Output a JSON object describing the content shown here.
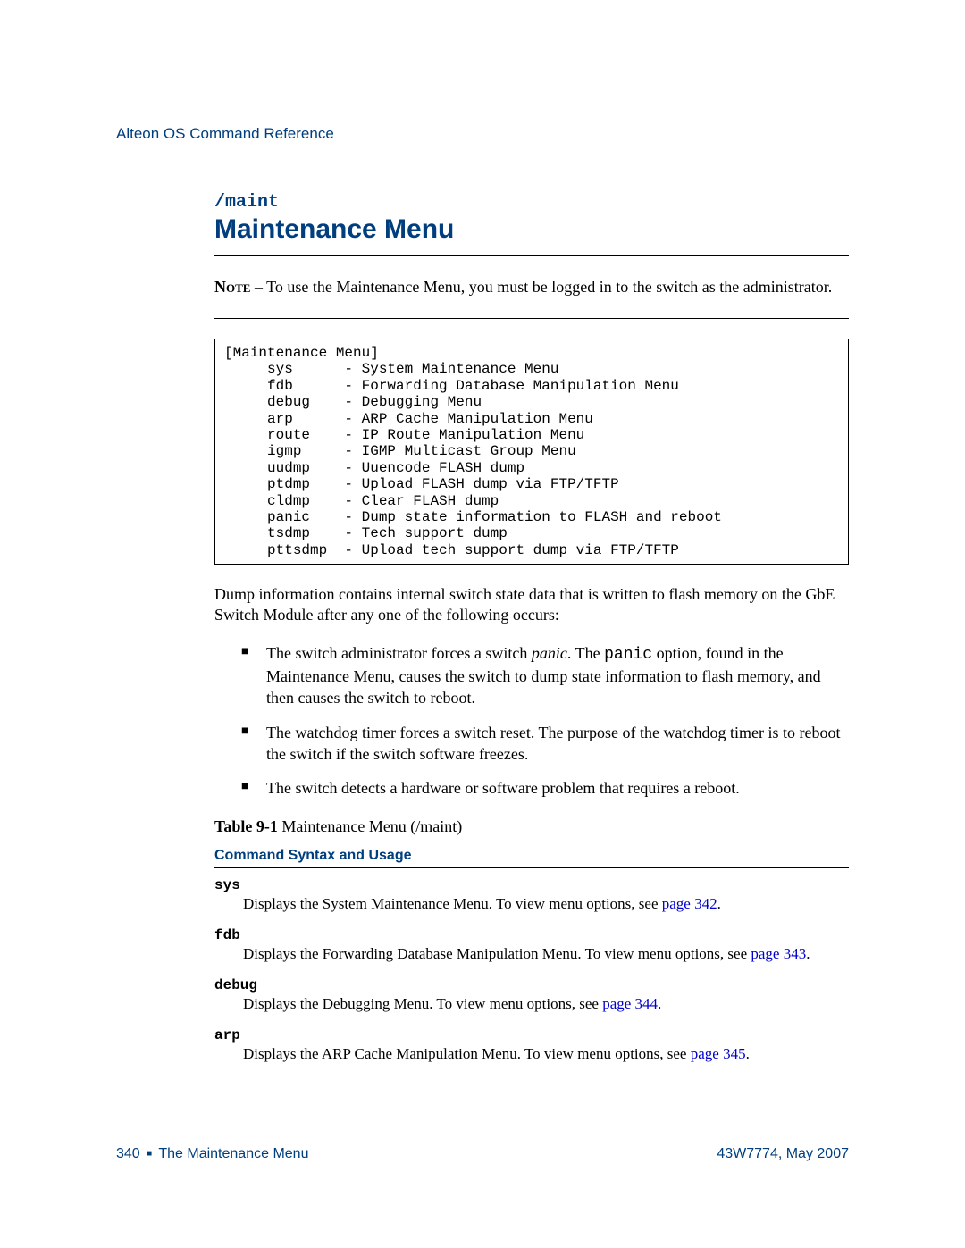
{
  "header": {
    "doc_ref": "Alteon OS Command Reference"
  },
  "title": {
    "path": "/maint",
    "heading": "Maintenance Menu"
  },
  "note": {
    "label": "Note –",
    "text": " To use the Maintenance Menu, you must be logged in to the switch as the administrator."
  },
  "terminal_block": "[Maintenance Menu]\n     sys      - System Maintenance Menu\n     fdb      - Forwarding Database Manipulation Menu\n     debug    - Debugging Menu\n     arp      - ARP Cache Manipulation Menu\n     route    - IP Route Manipulation Menu\n     igmp     - IGMP Multicast Group Menu\n     uudmp    - Uuencode FLASH dump\n     ptdmp    - Upload FLASH dump via FTP/TFTP\n     cldmp    - Clear FLASH dump\n     panic    - Dump state information to FLASH and reboot\n     tsdmp    - Tech support dump\n     pttsdmp  - Upload tech support dump via FTP/TFTP",
  "intro_para": {
    "part1": "Dump information contains internal switch state data that is written to flash memory on the ",
    "smallcaps": "GbE Switch Module",
    "part2": " after any one of the following occurs:"
  },
  "bullets": [
    {
      "pre": "The switch administrator forces a switch ",
      "italic": "panic",
      "post1": ". The ",
      "mono": "panic",
      "post2": " option, found in the Maintenance Menu, causes the switch to dump state information to flash memory, and then causes the switch to reboot."
    },
    {
      "text": "The watchdog timer forces a switch reset. The purpose of the watchdog timer is to reboot the switch if the switch software freezes."
    },
    {
      "text": "The switch detects a hardware or software problem that requires a reboot."
    }
  ],
  "table": {
    "label": "Table 9-1",
    "caption": "  Maintenance Menu (/maint)",
    "header": "Command Syntax and Usage",
    "rows": [
      {
        "cmd": "sys",
        "desc_pre": "Displays the System Maintenance Menu. To view menu options, see ",
        "link": "page 342",
        "desc_post": "."
      },
      {
        "cmd": "fdb",
        "desc_pre": "Displays the Forwarding Database Manipulation Menu. To view menu options, see ",
        "link": "page 343",
        "desc_post": "."
      },
      {
        "cmd": "debug",
        "desc_pre": "Displays the Debugging Menu. To view menu options, see ",
        "link": "page 344",
        "desc_post": "."
      },
      {
        "cmd": "arp",
        "desc_pre": "Displays the ARP Cache Manipulation Menu. To view menu options, see ",
        "link": "page 345",
        "desc_post": "."
      }
    ]
  },
  "footer": {
    "page_num": "340",
    "chapter": "The Maintenance Menu",
    "pub": "43W7774, May 2007"
  }
}
